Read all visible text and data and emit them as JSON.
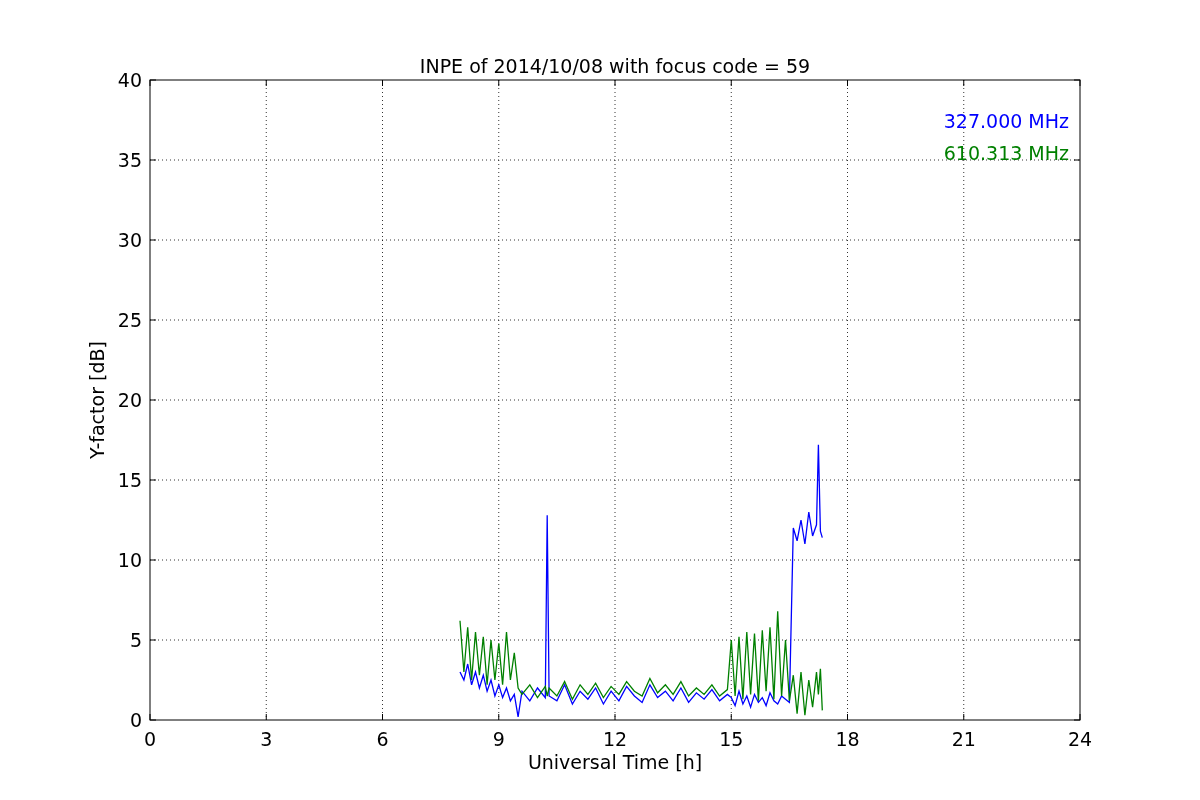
{
  "figure": {
    "chart_data": {
      "type": "line",
      "title": "INPE of 2014/10/08 with focus code = 59",
      "xlabel": "Universal Time [h]",
      "ylabel": "Y-factor [dB]",
      "x": [
        8.0,
        8.1,
        8.2,
        8.3,
        8.4,
        8.5,
        8.6,
        8.7,
        8.8,
        8.9,
        9.0,
        9.1,
        9.2,
        9.3,
        9.4,
        9.5,
        9.6,
        9.8,
        10.0,
        10.2,
        10.25,
        10.3,
        10.5,
        10.7,
        10.9,
        11.1,
        11.3,
        11.5,
        11.7,
        11.9,
        12.1,
        12.3,
        12.5,
        12.7,
        12.9,
        13.1,
        13.3,
        13.5,
        13.7,
        13.9,
        14.1,
        14.3,
        14.5,
        14.7,
        14.9,
        15.0,
        15.1,
        15.2,
        15.3,
        15.4,
        15.5,
        15.6,
        15.7,
        15.8,
        15.9,
        16.0,
        16.1,
        16.2,
        16.3,
        16.4,
        16.5,
        16.6,
        16.7,
        16.8,
        16.9,
        17.0,
        17.1,
        17.2,
        17.25,
        17.3,
        17.35
      ],
      "series": [
        {
          "name": "327.000 MHz",
          "color": "#0000ff",
          "values": [
            3,
            2.5,
            3.5,
            2.2,
            3,
            2,
            2.8,
            1.8,
            2.5,
            1.5,
            2.2,
            1.4,
            2,
            1.2,
            1.6,
            0.2,
            1.8,
            1.2,
            2,
            1.4,
            12.8,
            1.5,
            1.2,
            2.2,
            1,
            1.8,
            1.3,
            2,
            1,
            1.8,
            1.2,
            2.1,
            1.5,
            1.1,
            2.2,
            1.4,
            1.8,
            1.2,
            2,
            1.1,
            1.7,
            1.3,
            1.9,
            1.2,
            1.6,
            1.4,
            0.9,
            1.8,
            1,
            1.5,
            0.8,
            1.6,
            1.1,
            1.4,
            0.9,
            1.7,
            1.2,
            1,
            1.5,
            1.3,
            1.1,
            12,
            11.2,
            12.5,
            11,
            13,
            11.5,
            12.2,
            17.2,
            11.8,
            11.4
          ]
        },
        {
          "name": "610.313 MHz",
          "color": "#008000",
          "values": [
            6.2,
            3,
            5.8,
            2.5,
            5.5,
            2.8,
            5.2,
            2.2,
            5,
            2.5,
            4.8,
            2.2,
            5.5,
            2.5,
            4.2,
            2,
            1.6,
            2.2,
            1.4,
            2.1,
            1.5,
            2,
            1.5,
            2.4,
            1.3,
            2.2,
            1.6,
            2.3,
            1.4,
            2.1,
            1.6,
            2.4,
            1.8,
            1.5,
            2.6,
            1.7,
            2.2,
            1.6,
            2.4,
            1.5,
            2,
            1.6,
            2.2,
            1.5,
            1.9,
            5,
            1.5,
            5.2,
            1.3,
            5.5,
            1.6,
            5.4,
            1.2,
            5.6,
            1.8,
            5.8,
            1.3,
            6.8,
            1.5,
            5,
            1.2,
            2.8,
            0.4,
            3,
            0.3,
            2.5,
            0.8,
            3,
            1.6,
            3.2,
            0.6
          ]
        }
      ],
      "xlim": [
        0,
        24
      ],
      "ylim": [
        0,
        40
      ],
      "xticks": [
        0,
        3,
        6,
        9,
        12,
        15,
        18,
        21,
        24
      ],
      "yticks": [
        0,
        5,
        10,
        15,
        20,
        25,
        30,
        35,
        40
      ],
      "grid": true
    }
  }
}
